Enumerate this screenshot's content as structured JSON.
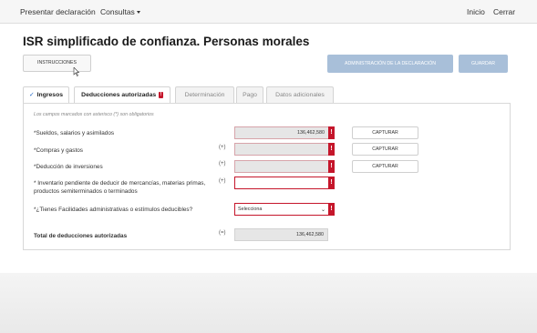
{
  "nav": {
    "presentar": "Presentar declaración",
    "consultas": "Consultas",
    "inicio": "Inicio",
    "cerrar": "Cerrar"
  },
  "page_title": "ISR simplificado de confianza. Personas morales",
  "buttons": {
    "instrucciones": "INSTRUCCIONES",
    "administracion": "ADMINISTRACIÓN DE LA DECLARACIÓN",
    "guardar": "GUARDAR"
  },
  "tabs": [
    {
      "label": "Ingresos",
      "active": false,
      "completed": true
    },
    {
      "label": "Deducciones autorizadas",
      "active": true,
      "badge": "!"
    },
    {
      "label": "Determinación",
      "active": false
    },
    {
      "label": "Pago",
      "active": false
    },
    {
      "label": "Datos adicionales",
      "active": false
    }
  ],
  "form": {
    "required_note": "Los campos marcados con asterisco (*) son obligatorios",
    "rows": [
      {
        "label": "*Sueldos, salarios y asimilados",
        "sign": "",
        "value": "136,462,580",
        "capture": "CAPTURAR"
      },
      {
        "label": "*Compras y gastos",
        "sign": "(+)",
        "value": "",
        "capture": "CAPTURAR"
      },
      {
        "label": "*Deducción de inversiones",
        "sign": "(+)",
        "value": "",
        "capture": "CAPTURAR"
      },
      {
        "label": "* Inventario pendiente de deducir de mercancías, materias primas, productos semiterminados o terminados",
        "sign": "(+)",
        "value": ""
      }
    ],
    "facilidades": {
      "label": "*¿Tienes Facilidades administrativas o estímulos deducibles?",
      "selected": "Selecciona"
    },
    "total": {
      "label": "Total de deducciones autorizadas",
      "sign": "(=)",
      "value": "136,462,580"
    },
    "error_marker": "!"
  },
  "colors": {
    "accent_blue": "#a8bfd9",
    "error_red": "#c5162b"
  }
}
